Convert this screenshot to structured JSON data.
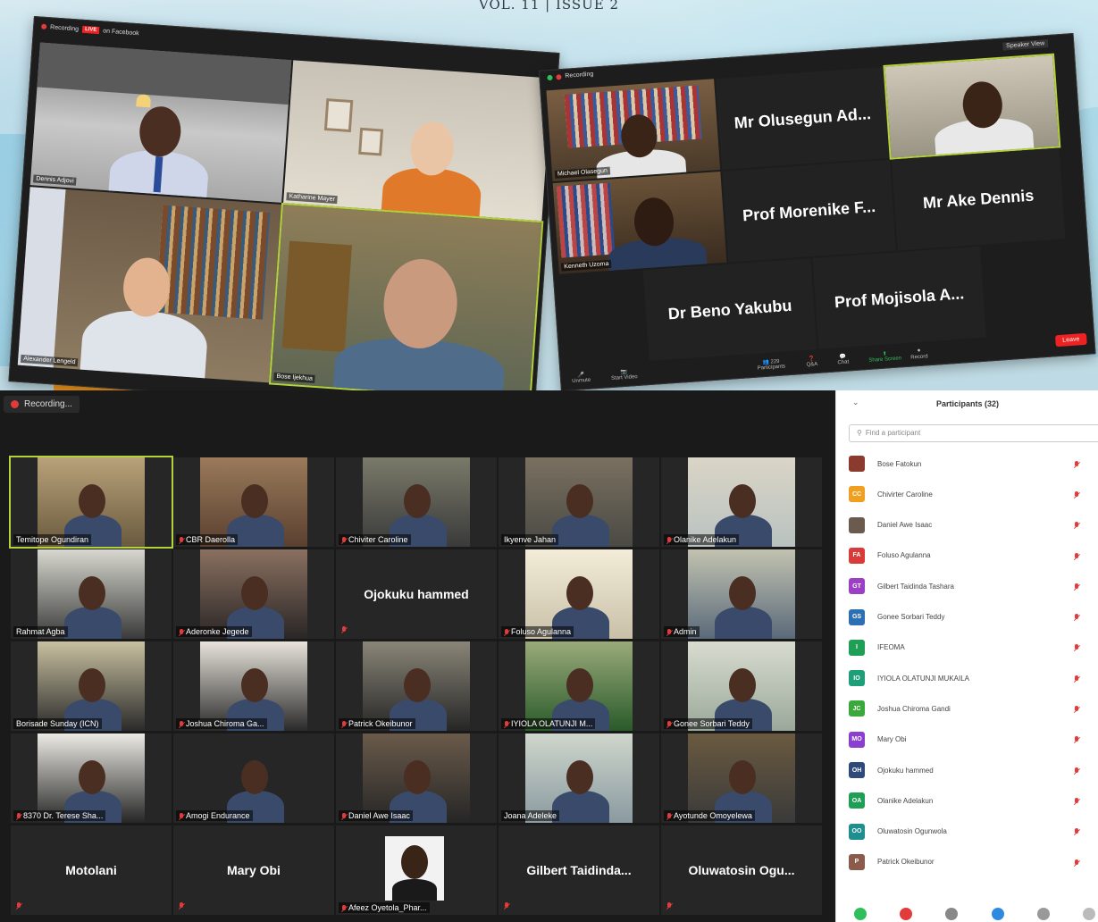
{
  "header": {
    "issue": "VOL. 11 | ISSUE 2"
  },
  "window1": {
    "recording": "Recording",
    "live": "LIVE",
    "on_facebook": "on Facebook",
    "tiles": [
      {
        "label": "Dennis Adjovi"
      },
      {
        "label": "Katharine Mayer"
      },
      {
        "label": "Alexander Lengeld"
      },
      {
        "label": "Bose Ijekhua"
      }
    ]
  },
  "window2": {
    "recording": "Recording",
    "speaker_view": "Speaker View",
    "tiles": [
      {
        "type": "video",
        "label": "Michael Olasegun"
      },
      {
        "type": "name",
        "name": "Mr Olusegun Ad..."
      },
      {
        "type": "video",
        "label": "Mr Ake Dennis"
      },
      {
        "type": "video",
        "label": "Kenneth Uzoma"
      },
      {
        "type": "name",
        "name": "Prof Morenike F..."
      },
      {
        "type": "name",
        "name": "Mr Ake Dennis"
      },
      {
        "type": "name",
        "name": "Dr Beno Yakubu"
      },
      {
        "type": "name",
        "name": "Prof Mojisola A..."
      }
    ],
    "toolbar": {
      "unmute": "Unmute",
      "start_video": "Start Video",
      "participants": "Participants",
      "participants_count": "229",
      "q_and_a": "Q&A",
      "chat": "Chat",
      "share_screen": "Share Screen",
      "record": "Record",
      "leave": "Leave"
    }
  },
  "meeting": {
    "recording": "Recording...",
    "grid": [
      {
        "label": "Temitope Ogundiran",
        "kind": "video",
        "active": true,
        "muted": false
      },
      {
        "label": "CBR Daerolla",
        "kind": "video",
        "muted": true
      },
      {
        "label": "Chiviter Caroline",
        "kind": "video",
        "muted": true
      },
      {
        "label": "Ikyenve Jahan",
        "kind": "video",
        "muted": false
      },
      {
        "label": "Olanike Adelakun",
        "kind": "video",
        "muted": true
      },
      {
        "label": "Rahmat Agba",
        "kind": "video",
        "muted": false
      },
      {
        "label": "Aderonke Jegede",
        "kind": "video",
        "muted": true
      },
      {
        "name": "Ojokuku hammed",
        "kind": "name",
        "muted": true
      },
      {
        "label": "Foluso Agulanna",
        "kind": "video",
        "muted": true
      },
      {
        "label": "Admin",
        "kind": "video",
        "muted": true
      },
      {
        "label": "Borisade Sunday (ICN)",
        "kind": "video",
        "muted": false
      },
      {
        "label": "Joshua Chiroma Ga...",
        "kind": "video",
        "muted": true
      },
      {
        "label": "Patrick Okeibunor",
        "kind": "video",
        "muted": true
      },
      {
        "label": "IYIOLA OLATUNJI M...",
        "kind": "video",
        "muted": true
      },
      {
        "label": "Gonee Sorbari Teddy",
        "kind": "video",
        "muted": true
      },
      {
        "label": "8370 Dr. Terese Sha...",
        "kind": "video",
        "muted": true
      },
      {
        "label": "Amogi Endurance",
        "kind": "video",
        "muted": true
      },
      {
        "label": "Daniel Awe Isaac",
        "kind": "video",
        "muted": true
      },
      {
        "label": "Joana Adeleke",
        "kind": "video",
        "muted": false
      },
      {
        "label": "Ayotunde Omoyelewa",
        "kind": "video",
        "muted": true
      },
      {
        "name": "Motolani",
        "kind": "name",
        "muted": true
      },
      {
        "name": "Mary Obi",
        "kind": "name",
        "muted": true
      },
      {
        "label": "Afeez Oyetola_Phar...",
        "kind": "photo",
        "muted": true
      },
      {
        "name": "Gilbert Taidinda...",
        "kind": "name",
        "muted": true
      },
      {
        "name": "Oluwatosin Ogu...",
        "kind": "name",
        "muted": true
      }
    ]
  },
  "participants_panel": {
    "title": "Participants (32)",
    "search_placeholder": "Find a participant",
    "items": [
      {
        "initials": "",
        "name": "Bose Fatokun",
        "color": "#8a3b2e"
      },
      {
        "initials": "CC",
        "name": "Chivirter Caroline",
        "color": "#f0a020"
      },
      {
        "initials": "",
        "name": "Daniel Awe Isaac",
        "color": "#6b5a4e"
      },
      {
        "initials": "FA",
        "name": "Foluso Agulanna",
        "color": "#d93a3a"
      },
      {
        "initials": "GT",
        "name": "Gilbert Taidinda Tashara",
        "color": "#9b3fc6"
      },
      {
        "initials": "GS",
        "name": "Gonee Sorbari Teddy",
        "color": "#2d6fb3"
      },
      {
        "initials": "I",
        "name": "IFEOMA",
        "color": "#1f9e55"
      },
      {
        "initials": "IO",
        "name": "IYIOLA OLATUNJI MUKAILA",
        "color": "#1f9e7a"
      },
      {
        "initials": "JC",
        "name": "Joshua Chiroma Gandi",
        "color": "#3aa83a"
      },
      {
        "initials": "MO",
        "name": "Mary Obi",
        "color": "#8a3fd0"
      },
      {
        "initials": "OH",
        "name": "Ojokuku hammed",
        "color": "#2e4a7a"
      },
      {
        "initials": "OA",
        "name": "Olanike Adelakun",
        "color": "#1f9e55"
      },
      {
        "initials": "OO",
        "name": "Oluwatosin Ogunwola",
        "color": "#1f8e8e"
      },
      {
        "initials": "P",
        "name": "Patrick Okeibunor",
        "color": "#8a5a4a"
      }
    ]
  }
}
